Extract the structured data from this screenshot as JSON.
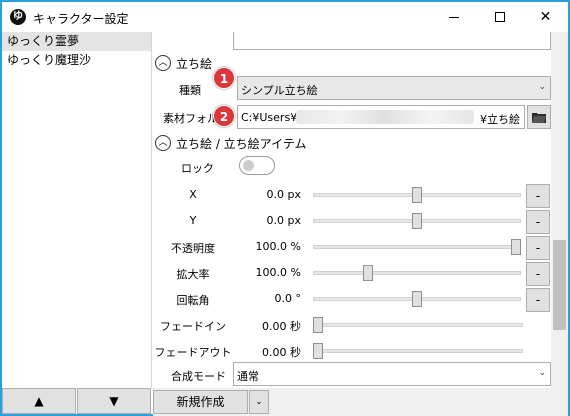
{
  "window": {
    "title": "キャラクター設定",
    "app_icon_glyph": "ゆ"
  },
  "characters": [
    {
      "name": "ゆっくり霊夢",
      "selected": true
    },
    {
      "name": "ゆっくり魔理沙",
      "selected": false
    }
  ],
  "left_nav": {
    "up_label": "▲",
    "down_label": "▼"
  },
  "section_tachie": {
    "title": "立ち絵",
    "type_label": "種類",
    "type_value": "シンプル立ち絵",
    "folder_label": "素材フォル",
    "folder_path_prefix": "C:¥Users¥",
    "folder_path_suffix": "¥立ち絵"
  },
  "section_items": {
    "title": "立ち絵 / 立ち絵アイテム",
    "lock_label": "ロック",
    "params": [
      {
        "label": "X",
        "value": "0.0 px",
        "level": 0.5
      },
      {
        "label": "Y",
        "value": "0.0 px",
        "level": 0.5
      },
      {
        "label": "不透明度",
        "value": "100.0 %",
        "level": 1.0
      },
      {
        "label": "拡大率",
        "value": "100.0 %",
        "level": 0.25
      },
      {
        "label": "回転角",
        "value": "0.0 °",
        "level": 0.5
      },
      {
        "label": "フェードイン",
        "value": "0.00 秒",
        "level": 0.0
      },
      {
        "label": "フェードアウト",
        "value": "0.00 秒",
        "level": 0.0
      }
    ],
    "minus_label": "-",
    "blend_label": "合成モード",
    "blend_value": "通常"
  },
  "badges": [
    "1",
    "2"
  ],
  "footer": {
    "new_button": "新規作成",
    "split_glyph": "⌄"
  },
  "colors": {
    "window_border": "#2a9fe0",
    "badge": "#d9373a"
  }
}
